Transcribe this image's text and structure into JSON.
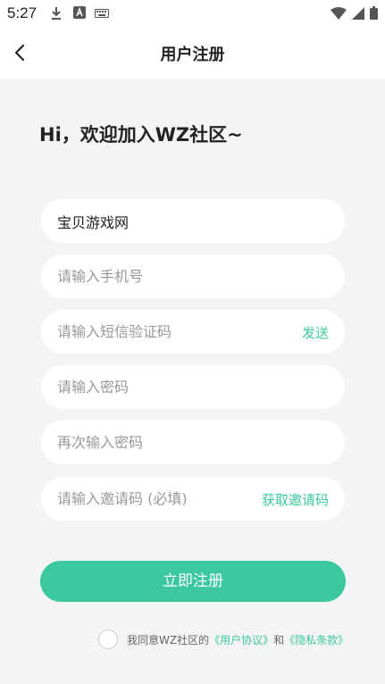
{
  "status_bar": {
    "time": "5:27",
    "icons": [
      "download-icon",
      "a-icon",
      "keyboard-icon",
      "wifi-icon",
      "signal-icon",
      "battery-icon"
    ]
  },
  "nav": {
    "title": "用户注册"
  },
  "headline": "Hi，欢迎加入WZ社区~",
  "form": {
    "username": {
      "value": "宝贝游戏网",
      "placeholder": ""
    },
    "phone": {
      "value": "",
      "placeholder": "请输入手机号"
    },
    "sms_code": {
      "value": "",
      "placeholder": "请输入短信验证码",
      "action_label": "发送"
    },
    "password": {
      "value": "",
      "placeholder": "请输入密码"
    },
    "password_confirm": {
      "value": "",
      "placeholder": "再次输入密码"
    },
    "invite_code": {
      "value": "",
      "placeholder": "请输入邀请码 (必填)",
      "action_label": "获取邀请码"
    }
  },
  "submit_label": "立即注册",
  "agreement": {
    "prefix": "我同意WZ社区的",
    "user_agreement": "《用户协议》",
    "and": "和",
    "privacy": "《隐私条款》",
    "checked": false
  },
  "colors": {
    "accent": "#3cc89f",
    "background": "#f4f4f4"
  }
}
